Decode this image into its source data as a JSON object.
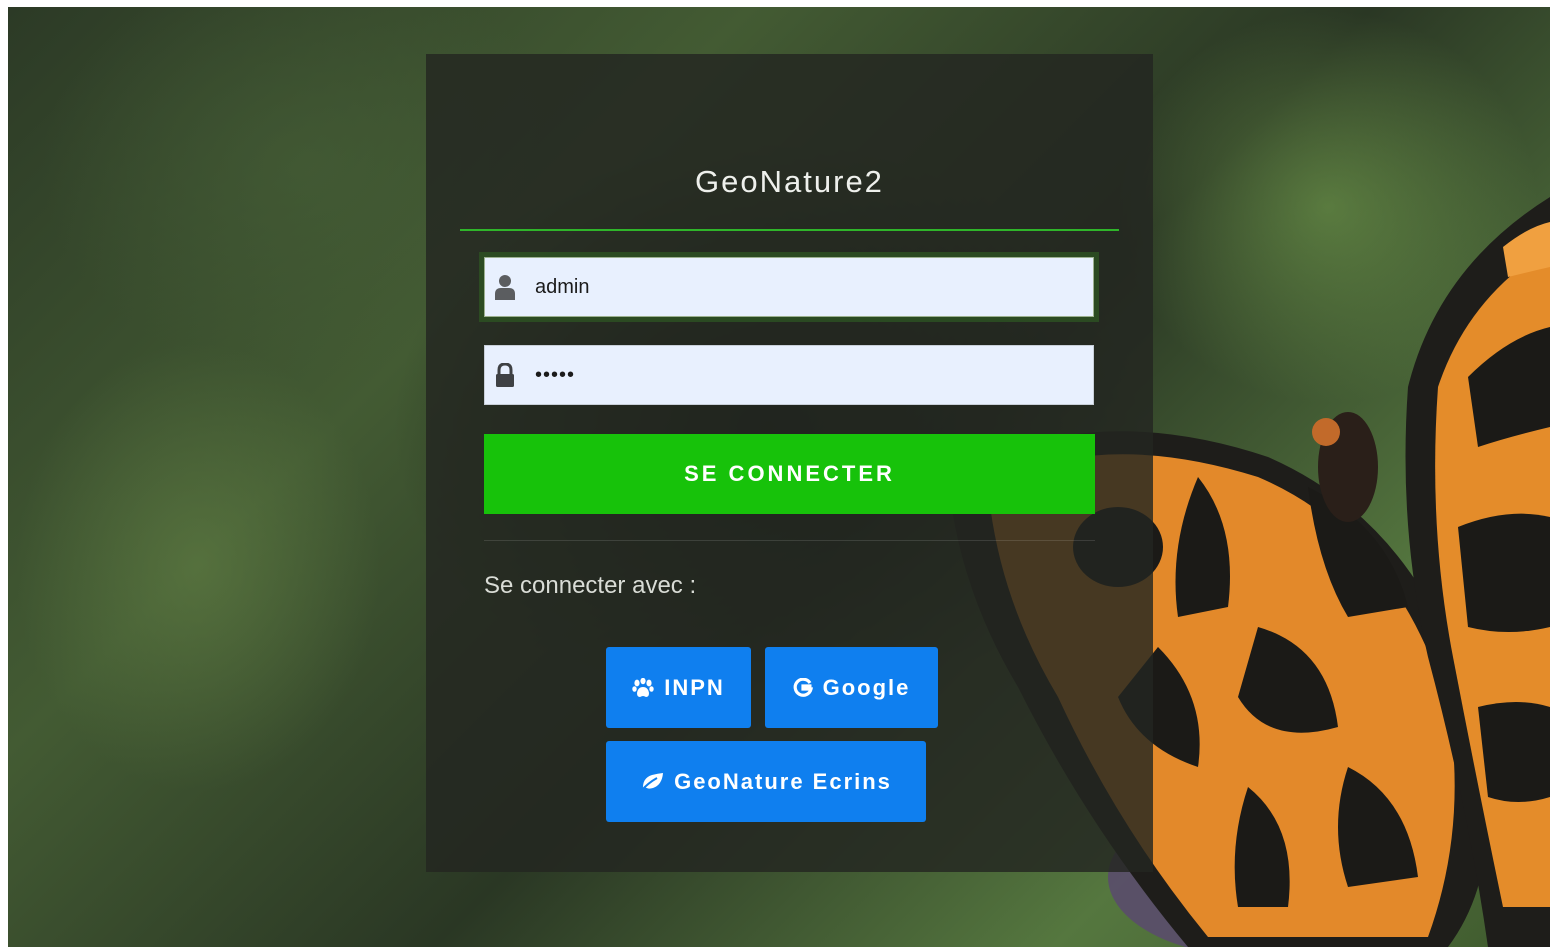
{
  "app": {
    "title": "GeoNature2"
  },
  "login_form": {
    "username": {
      "value": "admin",
      "icon": "user-icon"
    },
    "password": {
      "value": "admin",
      "icon": "lock-icon"
    },
    "submit_label": "SE CONNECTER"
  },
  "external_login": {
    "label": "Se connecter avec :",
    "providers": [
      {
        "label": "INPN",
        "icon": "paw-icon"
      },
      {
        "label": "Google",
        "icon": "google-icon"
      },
      {
        "label": "GeoNature Ecrins",
        "icon": "leaf-icon"
      }
    ]
  },
  "colors": {
    "accent_green": "#17c20a",
    "provider_blue": "#0f7fef",
    "divider_green": "#2fb52a"
  }
}
